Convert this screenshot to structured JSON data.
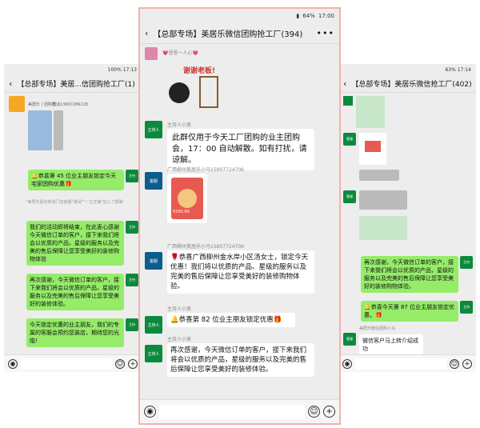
{
  "left": {
    "status": "100% 17:13",
    "title": "【总部专场】美居...信团购抢工厂(1)",
    "contact_name": "美居乐丨团购群",
    "contact_phone": "电话13607266218",
    "green1": "🔔恭喜第 45 位业主朋友锁定今天宅家团购优惠🎁",
    "sys": "\"美居乐股份新城门店客服\"邀请\"\"一生无悔\"加入了群聊",
    "green2": "我们的活动即将结束，在此衷心感谢今天微信订单的客户，接下来我们将会以优质的产品，星级的服务以及完美的售后保障让您享受美好的装修购物体验",
    "green3": "再次感谢，今天微信订单的客户，接下来我们将会以优质的产品，星级的服务以及完美的售后保障让您享受美好的装修体验。",
    "green4": "今天锁定优惠的业主朋友，我们的专属的客服会预约您装店，期待您的光临!"
  },
  "center": {
    "status_battery": "64%",
    "status_time": "17:00",
    "title": "【总部专场】美居乐微信团购抢工厂(394)",
    "sticker_sender": "💗恩恩一人心💗",
    "sticker_text": "谢谢老板!",
    "host_label": "主持人小美",
    "host_msg": "此群仅用于今天工厂团购的业主团购会，17：00 自动解散。如有打扰，请谅解。",
    "sender_guangxi": "广西柳州美居乐小马15807724706",
    "red_amount": "¥200.00",
    "guangxi_msg": "🌹恭喜广西柳州金水岸小区汤女士，锁定今天优惠！我们将以优质的产品、星级的服务以及完美的售后保障让您享受美好的装修购物体验。",
    "host_msg2": "🔔恭喜第 82 位业主朋友锁定优惠🎁",
    "host_msg3": "再次感谢，今天微信订单的客户，接下来我们将会以优质的产品，星级的服务以及完美的售后保障让您享受美好的装修体验。",
    "av_host": "主持人",
    "av_guangxi": "客服"
  },
  "right": {
    "status": "63% 17:14",
    "title": "【总部专场】美居乐微信抢工厂(402)",
    "green1": "再次感谢，今天微信订单的客户，接下来我们将会以优质的产品，星级的服务以及完美的售后保障让您享受美好的装修购物体验。",
    "green2": "🔔恭喜今天第 87 位业主朋友锁定优惠。🎁",
    "white1": "微信客户马上转介绍成功",
    "sender": "美居乐微信团购小马"
  }
}
